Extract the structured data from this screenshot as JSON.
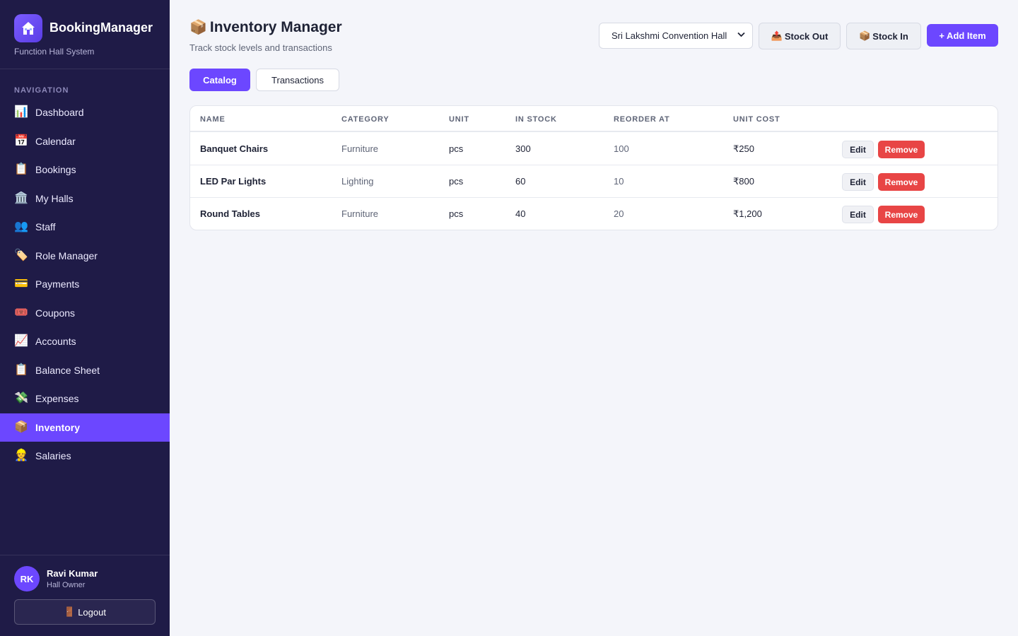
{
  "sidebar": {
    "brand": {
      "name": "BookingManager",
      "subtitle": "Function Hall System",
      "logo_icon": "house-icon"
    },
    "nav_heading": "NAVIGATION",
    "items": [
      {
        "id": "dashboard",
        "label": "Dashboard",
        "icon": "📊",
        "icon_name": "bar-chart-icon",
        "active": false
      },
      {
        "id": "calendar",
        "label": "Calendar",
        "icon": "📅",
        "icon_name": "calendar-icon",
        "active": false
      },
      {
        "id": "bookings",
        "label": "Bookings",
        "icon": "📋",
        "icon_name": "clipboard-icon",
        "active": false
      },
      {
        "id": "my-halls",
        "label": "My Halls",
        "icon": "🏛️",
        "icon_name": "building-icon",
        "active": false
      },
      {
        "id": "staff",
        "label": "Staff",
        "icon": "👥",
        "icon_name": "people-icon",
        "active": false
      },
      {
        "id": "role-manager",
        "label": "Role Manager",
        "icon": "🏷️",
        "icon_name": "tag-icon",
        "active": false
      },
      {
        "id": "payments",
        "label": "Payments",
        "icon": "💳",
        "icon_name": "credit-card-icon",
        "active": false
      },
      {
        "id": "coupons",
        "label": "Coupons",
        "icon": "🎟️",
        "icon_name": "ticket-icon",
        "active": false
      },
      {
        "id": "accounts",
        "label": "Accounts",
        "icon": "📈",
        "icon_name": "trend-chart-icon",
        "active": false
      },
      {
        "id": "balance-sheet",
        "label": "Balance Sheet",
        "icon": "📋",
        "icon_name": "clipboard-icon",
        "active": false
      },
      {
        "id": "expenses",
        "label": "Expenses",
        "icon": "💸",
        "icon_name": "money-wings-icon",
        "active": false
      },
      {
        "id": "inventory",
        "label": "Inventory",
        "icon": "📦",
        "icon_name": "package-icon",
        "active": true
      },
      {
        "id": "salaries",
        "label": "Salaries",
        "icon": "👷",
        "icon_name": "worker-icon",
        "active": false
      }
    ],
    "user": {
      "initials": "RK",
      "name": "Ravi Kumar",
      "role": "Hall Owner"
    },
    "logout": {
      "icon": "🚪",
      "label": "Logout"
    }
  },
  "header": {
    "title_icon": "📦",
    "title": "Inventory Manager",
    "subtitle": "Track stock levels and transactions",
    "hall_select": {
      "value": "Sri Lakshmi Convention Hall"
    },
    "stock_out": {
      "icon": "📤",
      "label": "Stock Out"
    },
    "stock_in": {
      "icon": "📦",
      "label": "Stock In"
    },
    "add_item": "+ Add Item"
  },
  "tabs": [
    {
      "label": "Catalog",
      "active": true
    },
    {
      "label": "Transactions",
      "active": false
    }
  ],
  "table": {
    "columns": [
      "NAME",
      "CATEGORY",
      "UNIT",
      "IN STOCK",
      "REORDER AT",
      "UNIT COST"
    ],
    "edit_label": "Edit",
    "remove_label": "Remove",
    "rows": [
      {
        "name": "Banquet Chairs",
        "category": "Furniture",
        "unit": "pcs",
        "in_stock": "300",
        "reorder_at": "100",
        "unit_cost": "₹250"
      },
      {
        "name": "LED Par Lights",
        "category": "Lighting",
        "unit": "pcs",
        "in_stock": "60",
        "reorder_at": "10",
        "unit_cost": "₹800"
      },
      {
        "name": "Round Tables",
        "category": "Furniture",
        "unit": "pcs",
        "in_stock": "40",
        "reorder_at": "20",
        "unit_cost": "₹1,200"
      }
    ]
  },
  "colors": {
    "sidebar_bg": "#1f1b47",
    "accent": "#6c47ff",
    "danger": "#e84545",
    "page_bg": "#f4f5fa"
  }
}
